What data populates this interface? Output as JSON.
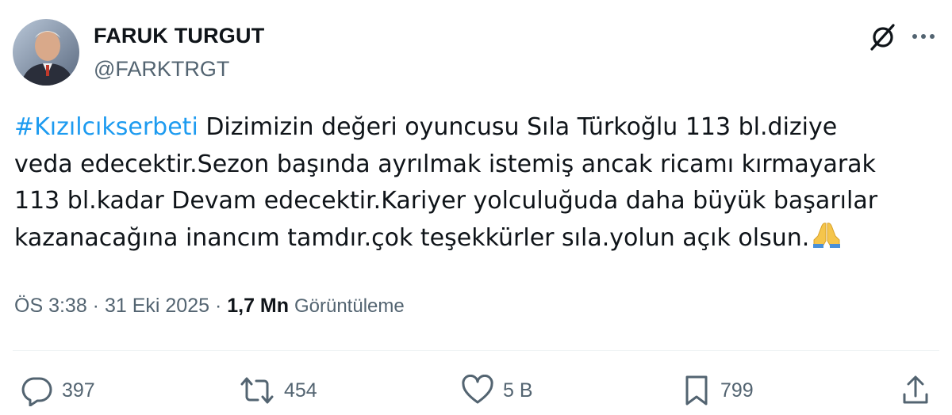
{
  "tweet": {
    "author": {
      "display_name": "FARUK TURGUT",
      "handle": "@FARKTRGT"
    },
    "header_icons": {
      "grok": "grok-icon",
      "more": "more-icon"
    },
    "text_lines": {
      "hashtag": "#Kızılcıkserbeti",
      "line1_rest": " Dizimizin değeri oyuncusu Sıla Türkoğlu 113 bl.diziye",
      "line2": "veda edecektir.Sezon başında ayrılmak istemiş ancak ricamı kırmayarak",
      "line3": "113 bl.kadar Devam edecektir.Kariyer yolculuğuda daha büyük başarılar",
      "line4": "kazanacağına inancım tamdır.çok teşekkürler sıla.yolun açık olsun."
    },
    "emoji": "folded-hands-emoji",
    "meta": {
      "time": "ÖS 3:38",
      "separator": " · ",
      "date": "31 Eki 2025",
      "views_count": "1,7 Mn",
      "views_label": "Görüntüleme"
    },
    "actions": {
      "replies": "397",
      "retweets": "454",
      "likes": "5 B",
      "bookmarks": "799",
      "share_icon": "share-icon"
    },
    "colors": {
      "hashtag": "#1d9bf0",
      "text": "#0f1419",
      "secondary": "#536471",
      "divider": "#eff3f4"
    }
  }
}
